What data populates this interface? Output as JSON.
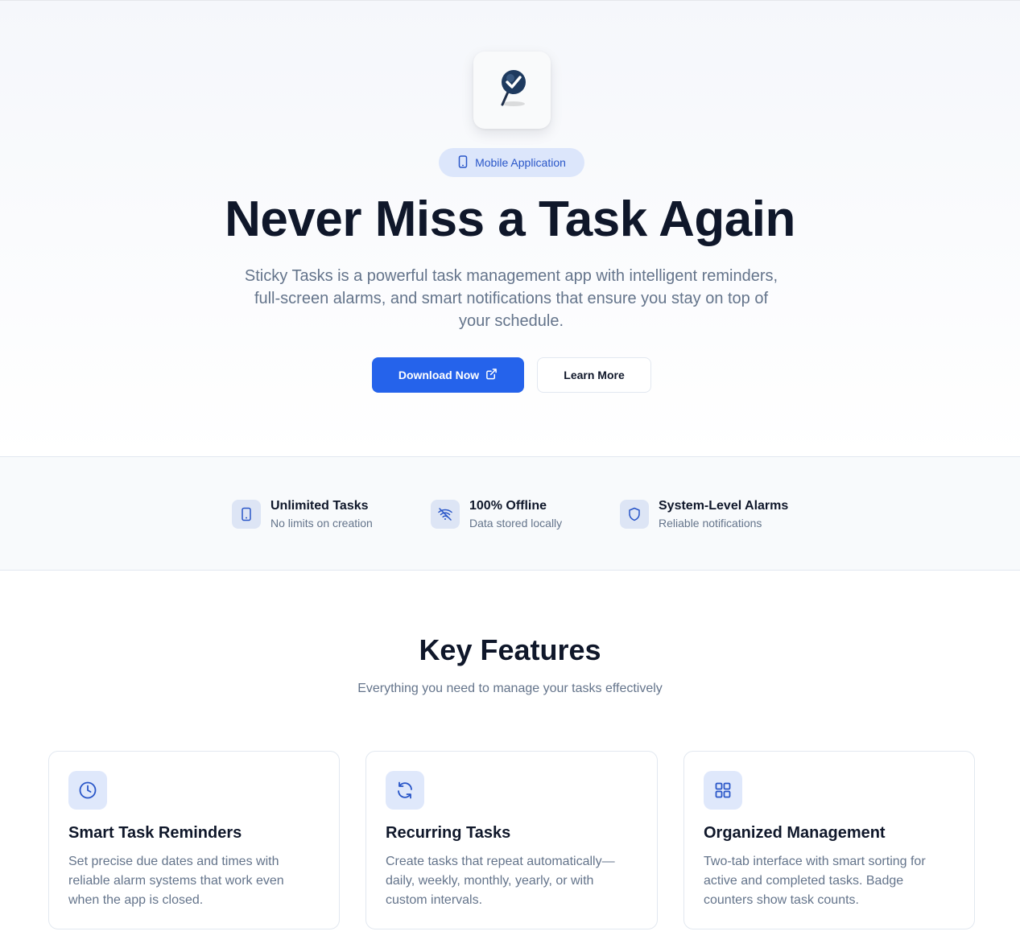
{
  "colors": {
    "accent": "#2563eb",
    "badge_bg": "#dce6fb",
    "heading": "#0f172a",
    "muted": "#64748b"
  },
  "hero": {
    "app_icon": "pin-check-icon",
    "badge_icon": "smartphone-icon",
    "badge_label": "Mobile Application",
    "title": "Never Miss a Task Again",
    "subtitle": "Sticky Tasks is a powerful task management app with intelligent reminders, full-screen alarms, and smart notifications that ensure you stay on top of your schedule.",
    "primary_button": "Download Now",
    "primary_button_icon": "external-link-icon",
    "secondary_button": "Learn More"
  },
  "stats": [
    {
      "icon": "smartphone-icon",
      "title": "Unlimited Tasks",
      "desc": "No limits on creation"
    },
    {
      "icon": "wifi-off-icon",
      "title": "100% Offline",
      "desc": "Data stored locally"
    },
    {
      "icon": "shield-icon",
      "title": "System-Level Alarms",
      "desc": "Reliable notifications"
    }
  ],
  "features": {
    "title": "Key Features",
    "subtitle": "Everything you need to manage your tasks effectively",
    "cards": [
      {
        "icon": "clock-icon",
        "title": "Smart Task Reminders",
        "desc": "Set precise due dates and times with reliable alarm systems that work even when the app is closed."
      },
      {
        "icon": "refresh-icon",
        "title": "Recurring Tasks",
        "desc": "Create tasks that repeat automatically—daily, weekly, monthly, yearly, or with custom intervals."
      },
      {
        "icon": "grid-icon",
        "title": "Organized Management",
        "desc": "Two-tab interface with smart sorting for active and completed tasks. Badge counters show task counts."
      }
    ]
  }
}
